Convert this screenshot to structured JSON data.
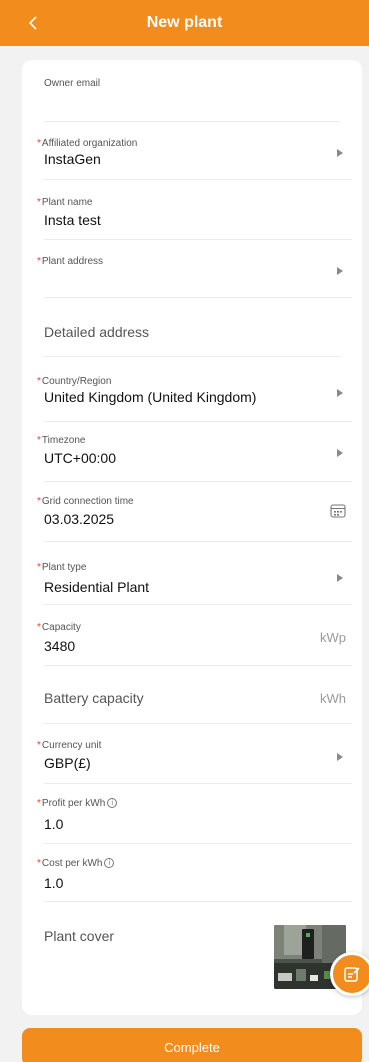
{
  "header": {
    "back_icon": "chevron-left-icon",
    "title": "New plant"
  },
  "form": {
    "owner_email": {
      "placeholder": "Owner email",
      "value": ""
    },
    "affiliated_organization": {
      "label": "Affiliated organization",
      "required": true,
      "value": "InstaGen"
    },
    "plant_name": {
      "label": "Plant name",
      "required": true,
      "value": "Insta test"
    },
    "plant_address": {
      "label": "Plant address",
      "required": true,
      "value": ""
    },
    "detailed_address": {
      "placeholder": "Detailed address",
      "value": ""
    },
    "country_region": {
      "label": "Country/Region",
      "required": true,
      "value": "United Kingdom (United Kingdom)"
    },
    "timezone": {
      "label": "Timezone",
      "required": true,
      "value": "UTC+00:00"
    },
    "grid_connection_time": {
      "label": "Grid connection time",
      "required": true,
      "value": "03.03.2025",
      "icon": "calendar-icon"
    },
    "plant_type": {
      "label": "Plant type",
      "required": true,
      "value": "Residential Plant"
    },
    "capacity": {
      "label": "Capacity",
      "required": true,
      "value": "3480",
      "unit": "kWp"
    },
    "battery_capacity": {
      "placeholder": "Battery capacity",
      "value": "",
      "unit": "kWh"
    },
    "currency_unit": {
      "label": "Currency unit",
      "required": true,
      "value": "GBP(£)"
    },
    "profit_per_kwh": {
      "label": "Profit per kWh",
      "required": true,
      "value": "1.0",
      "icon": "info-icon"
    },
    "cost_per_kwh": {
      "label": "Cost per kWh",
      "required": true,
      "value": "1.0",
      "icon": "info-icon"
    },
    "plant_cover": {
      "label": "Plant cover",
      "image": "plant-cover-photo"
    }
  },
  "fab": {
    "icon": "edit-note-icon"
  },
  "footer": {
    "complete_label": "Complete"
  },
  "colors": {
    "accent": "#f28d1d",
    "required_star": "#e0422f",
    "background": "#f2f2f2",
    "card": "#ffffff"
  }
}
